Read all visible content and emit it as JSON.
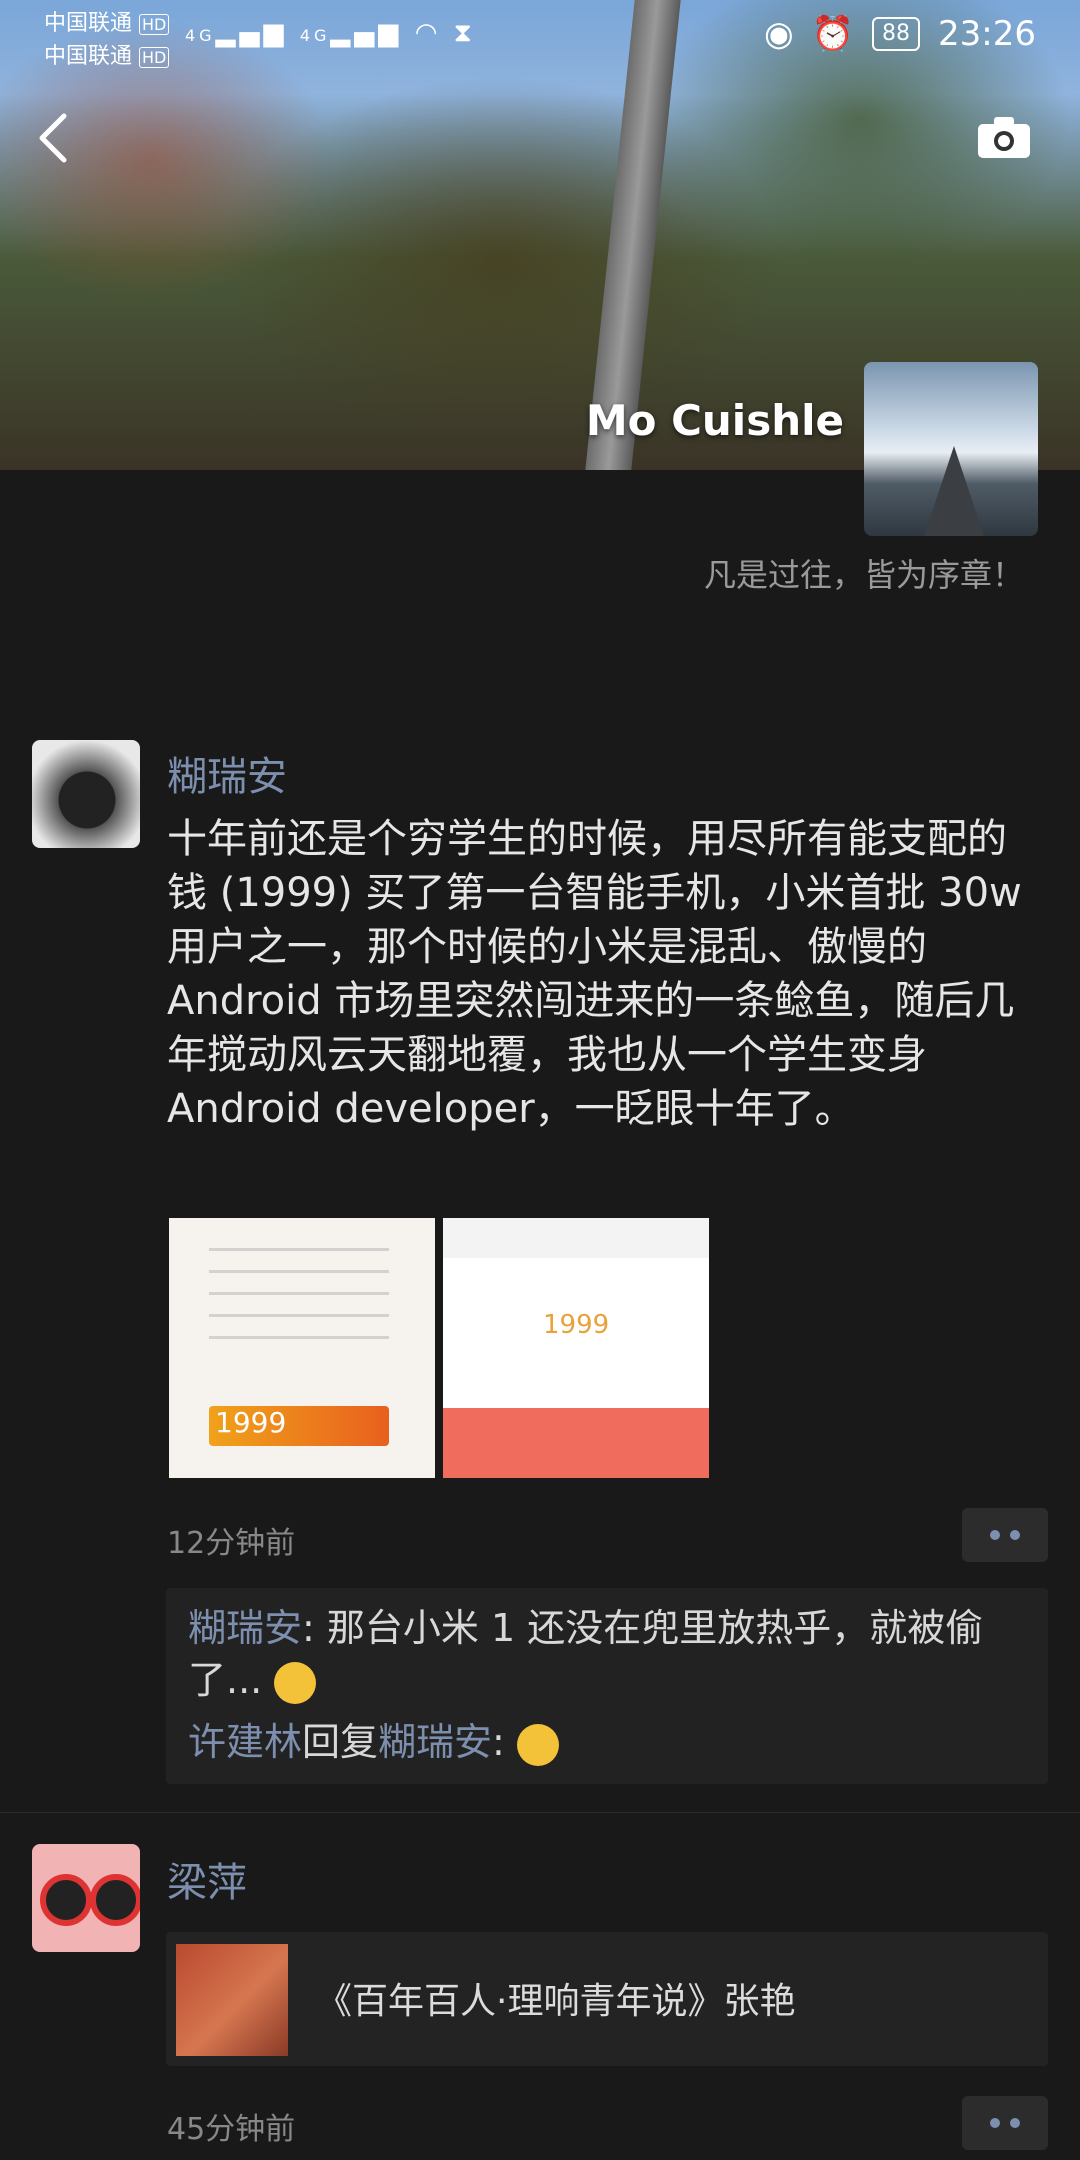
{
  "status_bar": {
    "carrier1": "中国联通",
    "carrier2": "中国联通",
    "hd1": "HD",
    "hd2": "HD",
    "net1": "4G",
    "net2": "4G",
    "battery": "88",
    "time": "23:26"
  },
  "profile": {
    "name": "Mo Cuishle",
    "signature": "凡是过往，皆为序章！"
  },
  "posts": [
    {
      "author": "糊瑞安",
      "text": "十年前还是个穷学生的时候，用尽所有能支配的钱 (1999) 买了第一台智能手机，小米首批 30w 用户之一，那个时候的小米是混乱、傲慢的 Android 市场里突然闯进来的一条鲶鱼，随后几年搅动风云天翻地覆，我也从一个学生变身 Android developer，一眨眼十年了。",
      "time": "12分钟前",
      "thumb1_price": "1999",
      "thumb2_price": "1999",
      "comments": [
        {
          "name": "糊瑞安",
          "text": ": 那台小米 1 还没在兜里放热乎，就被偷了..."
        },
        {
          "name": "许建林",
          "reply_word": "回复",
          "to": "糊瑞安",
          "text": ": "
        }
      ]
    },
    {
      "author": "梁萍",
      "link_title": "《百年百人·理响青年说》张艳",
      "time": "45分钟前"
    }
  ]
}
